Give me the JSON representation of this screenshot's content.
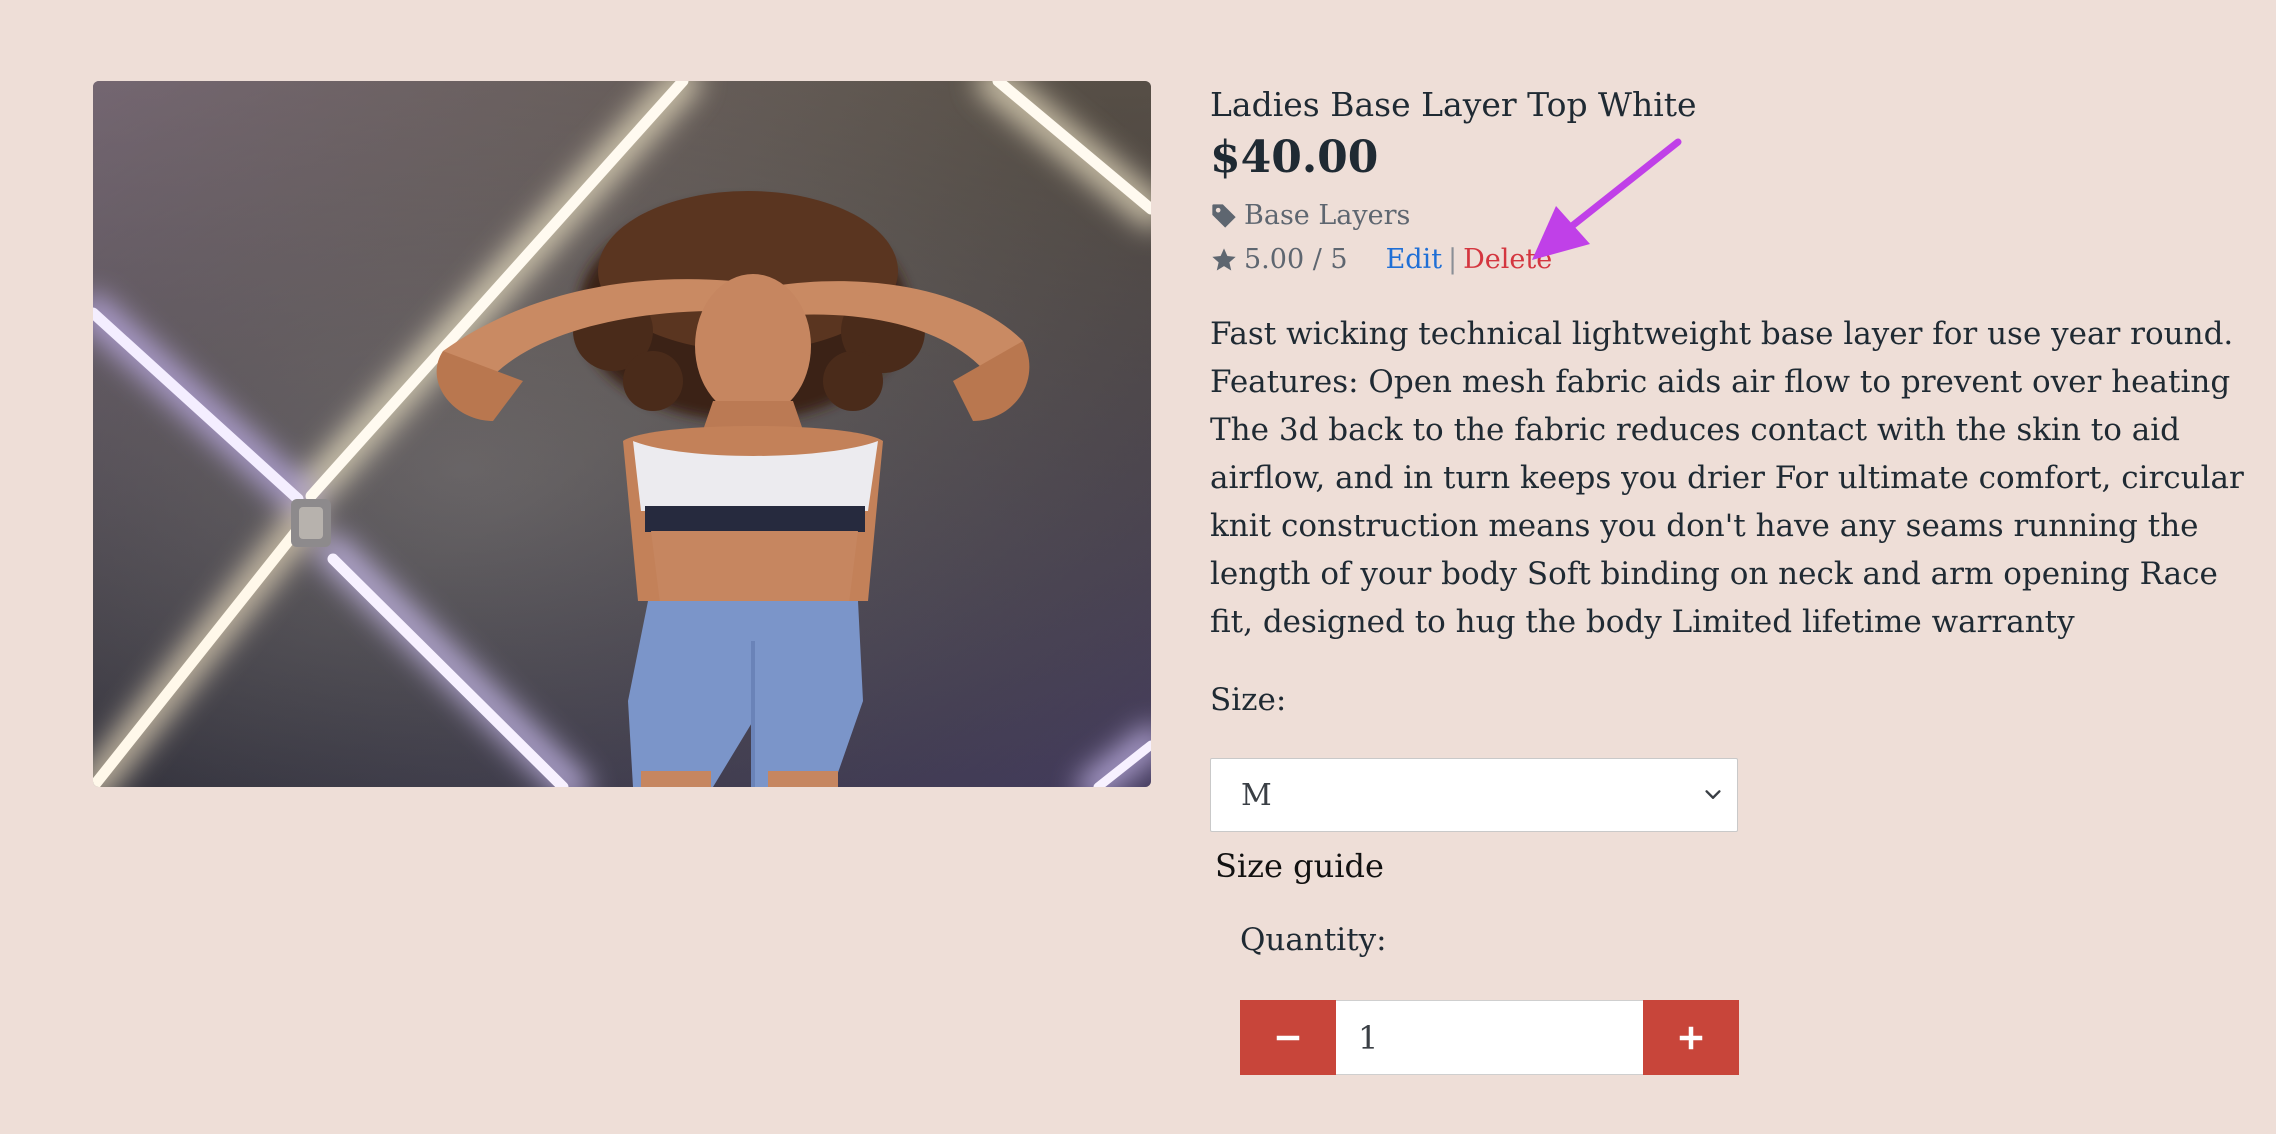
{
  "product": {
    "title": "Ladies Base Layer Top White",
    "price": "$40.00",
    "category": "Base Layers",
    "category_icon": "tag-icon",
    "rating": "5.00 / 5",
    "rating_icon": "star-icon",
    "image_alt": "Ladies Base Layer Top White",
    "description": "Fast wicking technical lightweight base layer for use year round. Features: Open mesh fabric aids air flow to prevent over heating The 3d back to the fabric reduces contact with the skin to aid airflow, and in turn keeps you drier For ultimate comfort, circular knit construction means you don't have any seams running the length of your body Soft binding on neck and arm opening Race fit, designed to hug the body Limited lifetime warranty"
  },
  "admin": {
    "edit_label": "Edit",
    "separator": "|",
    "delete_label": "Delete"
  },
  "size": {
    "label": "Size:",
    "selected": "M",
    "guide_label": "Size guide"
  },
  "quantity": {
    "label": "Quantity:",
    "value": "1",
    "decrement_icon": "minus-icon",
    "increment_icon": "plus-icon"
  },
  "colors": {
    "background": "#eeded7",
    "edit_link": "#1f6fd6",
    "delete_link": "#d4363f",
    "quantity_button": "#c8453a",
    "annotation_arrow": "#c040e8"
  }
}
